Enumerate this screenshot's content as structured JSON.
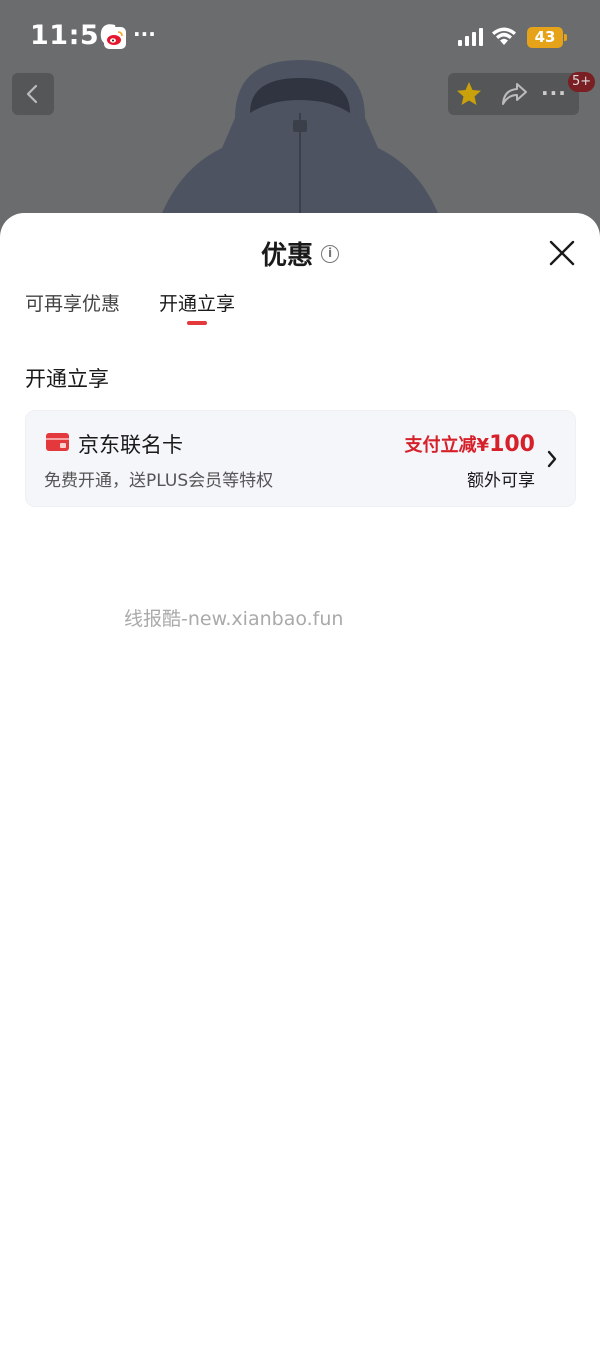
{
  "status_bar": {
    "time": "11:56",
    "notification_icons": [
      "weibo-icon",
      "more-dots-icon"
    ],
    "more_dots": "···",
    "battery_level": "43",
    "battery_color": "#e6a319"
  },
  "product_header": {
    "badge": "5+",
    "icons": [
      "back-icon",
      "star-icon",
      "share-icon",
      "more-icon"
    ],
    "more_text": "···"
  },
  "sheet": {
    "title": "优惠",
    "info_symbol": "i",
    "tabs": [
      {
        "label": "可再享优惠",
        "active": false
      },
      {
        "label": "开通立享",
        "active": true
      }
    ],
    "section_title": "开通立享",
    "card": {
      "name": "京东联名卡",
      "description": "免费开通，送PLUS会员等特权",
      "offer_label": "支付立减",
      "offer_currency": "¥",
      "offer_amount": "100",
      "extra": "额外可享"
    },
    "watermark": "线报酷-new.xianbao.fun"
  },
  "colors": {
    "accent": "#e4393c",
    "offer_red": "#d6202a",
    "card_bg": "#f5f6fa",
    "overlay_bg": "#6b6c6e"
  }
}
